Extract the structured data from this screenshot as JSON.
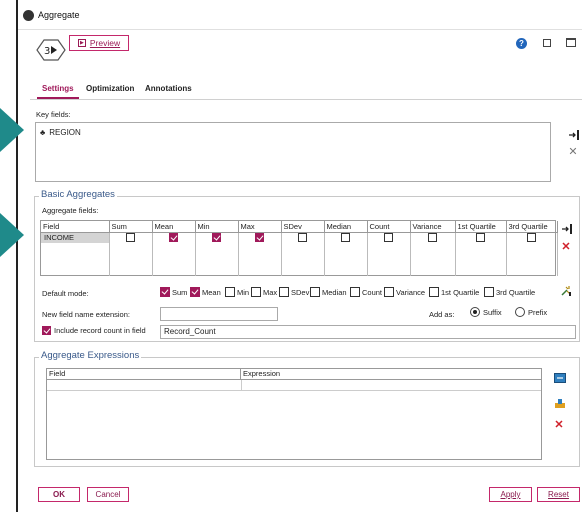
{
  "window": {
    "title": "Aggregate"
  },
  "header": {
    "preview_label": "Preview"
  },
  "tabs": [
    {
      "label": "Settings"
    },
    {
      "label": "Optimization"
    },
    {
      "label": "Annotations"
    }
  ],
  "key_fields": {
    "label": "Key fields:",
    "items": [
      "REGION"
    ]
  },
  "basic_aggregates": {
    "legend": "Basic Aggregates",
    "table_label": "Aggregate fields:",
    "columns": [
      "Field",
      "Sum",
      "Mean",
      "Min",
      "Max",
      "SDev",
      "Median",
      "Count",
      "Variance",
      "1st Quartile",
      "3rd Quartile"
    ],
    "rows": [
      {
        "field": "INCOME",
        "checks": [
          false,
          true,
          true,
          true,
          false,
          false,
          false,
          false,
          false,
          false
        ]
      }
    ],
    "default_mode": {
      "label": "Default mode:",
      "options": [
        {
          "label": "Sum",
          "checked": true
        },
        {
          "label": "Mean",
          "checked": true
        },
        {
          "label": "Min",
          "checked": false
        },
        {
          "label": "Max",
          "checked": false
        },
        {
          "label": "SDev",
          "checked": false
        },
        {
          "label": "Median",
          "checked": false
        },
        {
          "label": "Count",
          "checked": false
        },
        {
          "label": "Variance",
          "checked": false
        },
        {
          "label": "1st Quartile",
          "checked": false
        },
        {
          "label": "3rd Quartile",
          "checked": false
        }
      ]
    },
    "extension_label": "New field name extension:",
    "extension_value": "",
    "add_as_label": "Add as:",
    "add_as_options": [
      {
        "label": "Suffix",
        "selected": true
      },
      {
        "label": "Prefix",
        "selected": false
      }
    ],
    "record_count_label": "Include record count in field",
    "record_count_checked": true,
    "record_count_value": "Record_Count"
  },
  "aggregate_expressions": {
    "legend": "Aggregate Expressions",
    "columns": [
      "Field",
      "Expression"
    ]
  },
  "footer": {
    "ok_label": "OK",
    "cancel_label": "Cancel",
    "apply_label": "Apply",
    "reset_label": "Reset"
  },
  "colors": {
    "accent": "#a0195a",
    "teal_arrow": "#1f8a8a",
    "legend_text": "#3a5a8a"
  }
}
